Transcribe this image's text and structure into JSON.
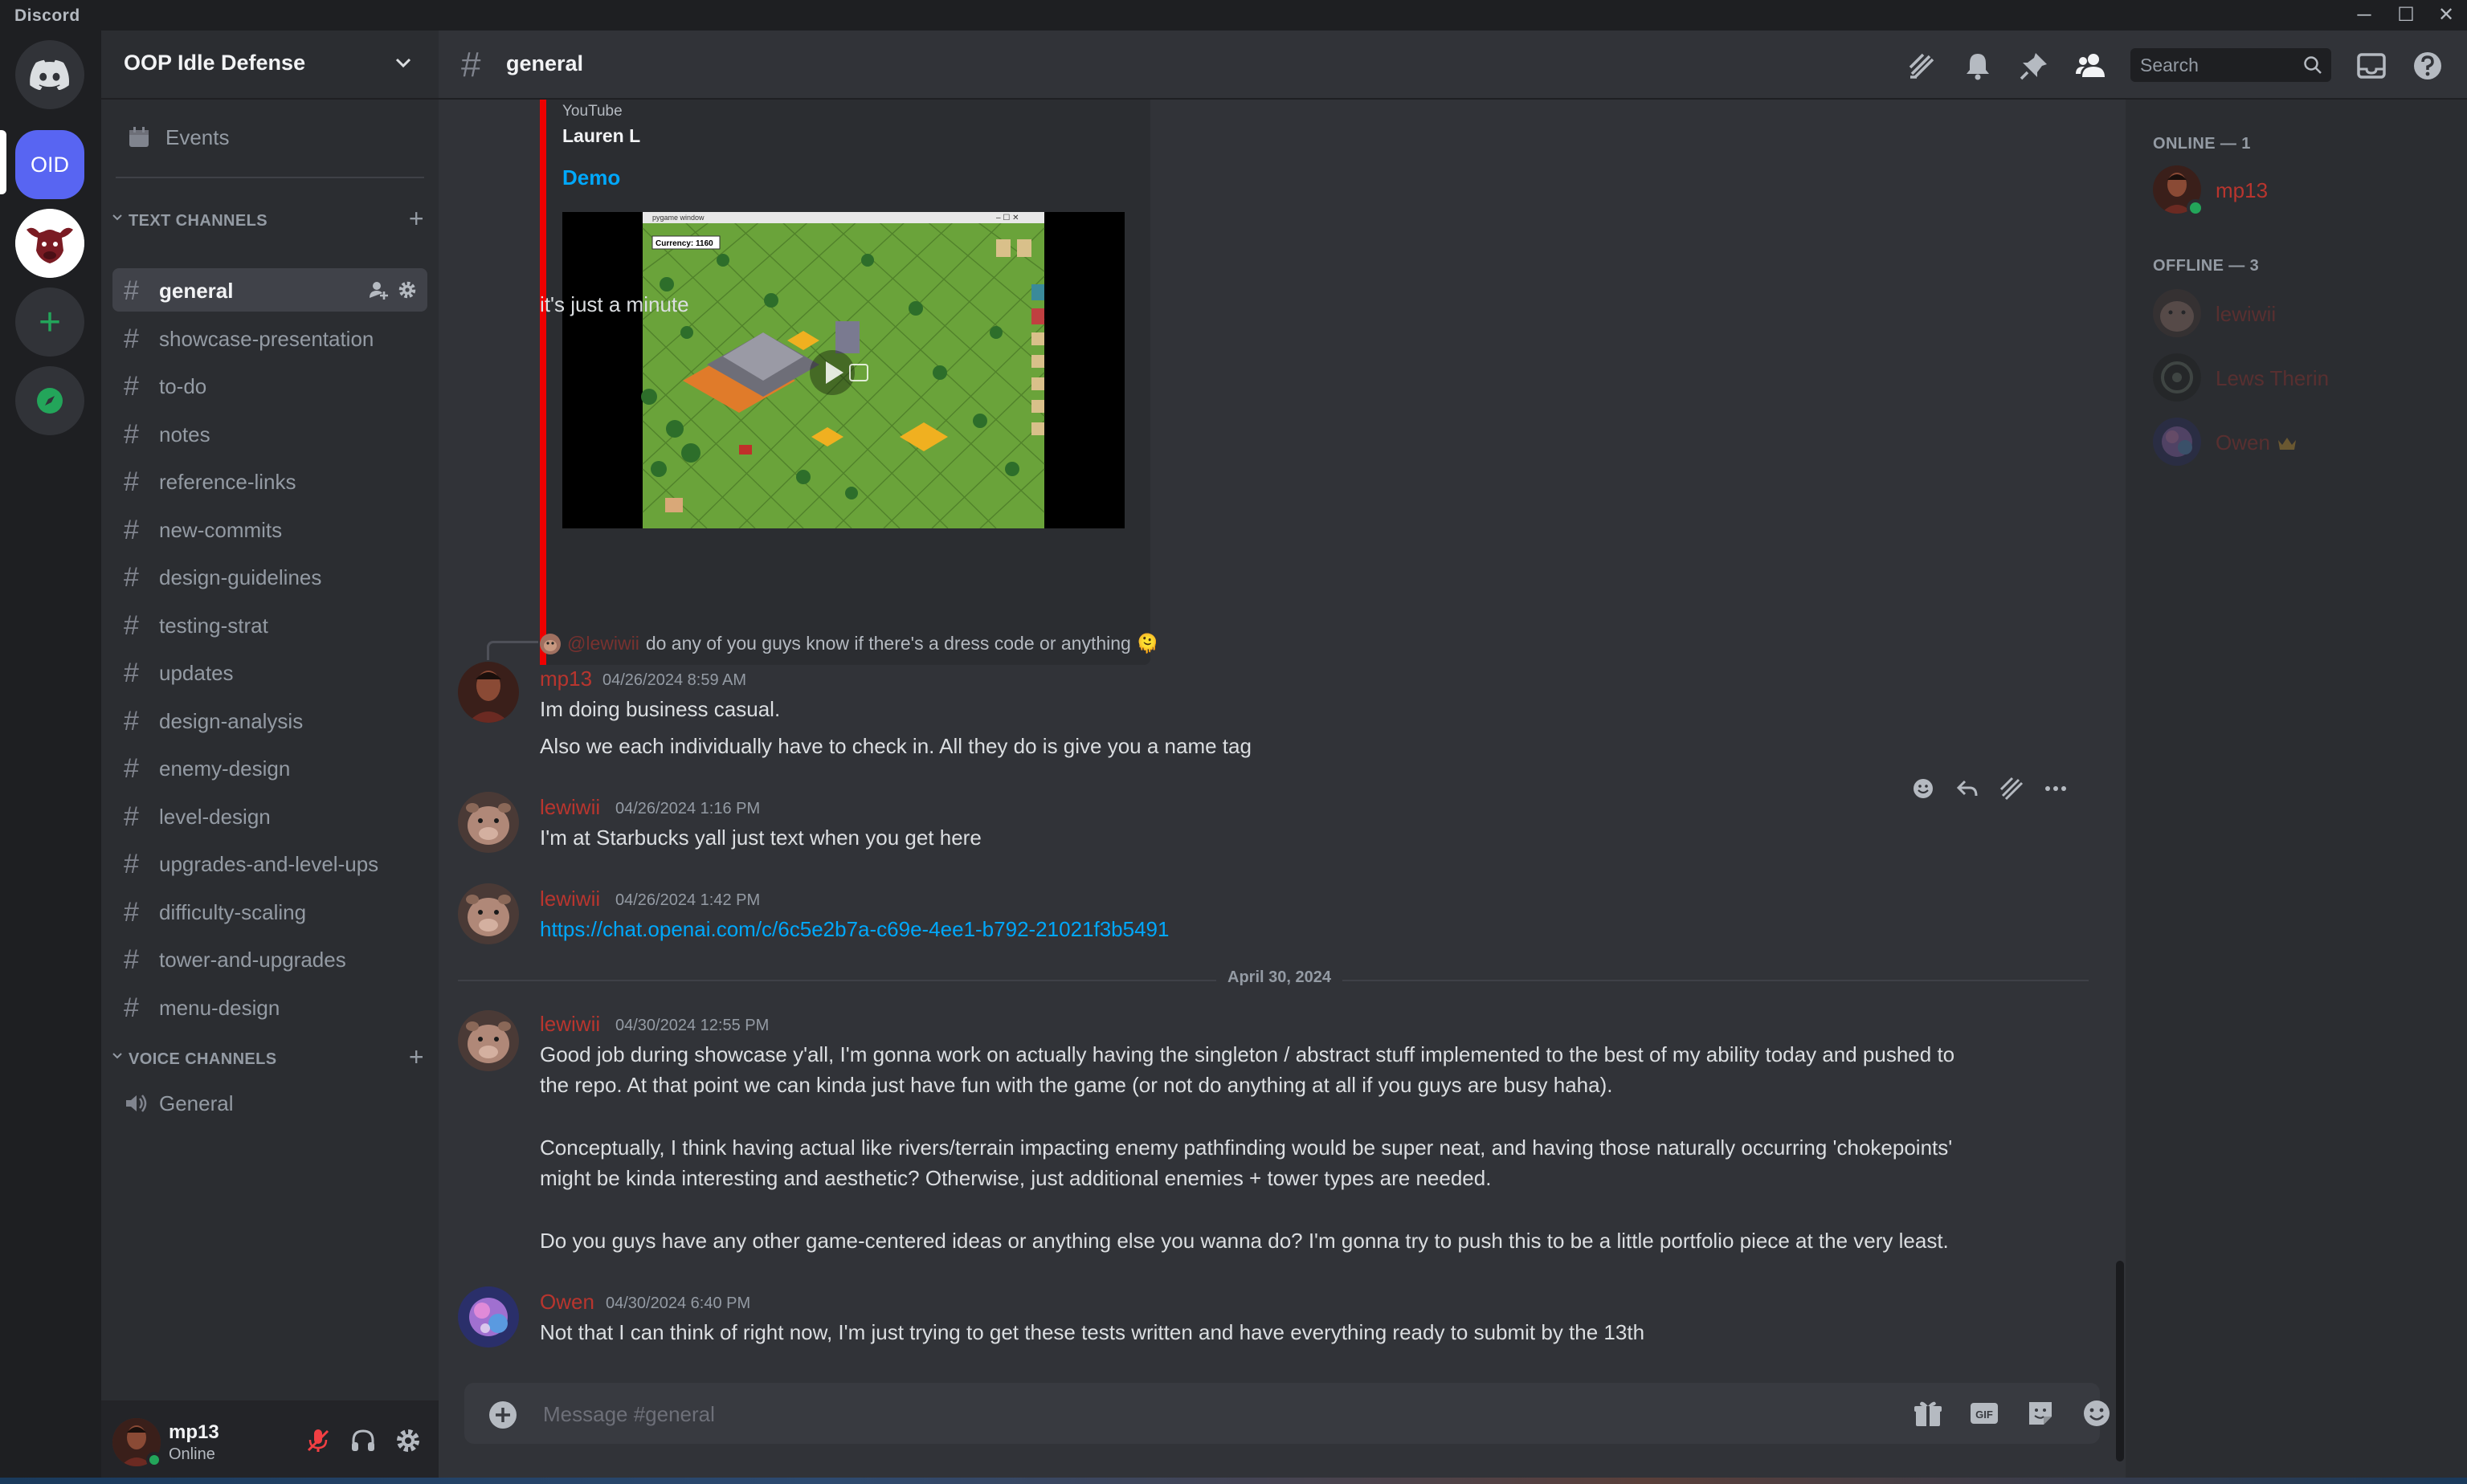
{
  "app": {
    "title": "Discord"
  },
  "server": {
    "name": "OOP Idle Defense",
    "rail": {
      "active_label": "OID"
    }
  },
  "sidebar": {
    "events_label": "Events",
    "text_category": "TEXT CHANNELS",
    "voice_category": "VOICE CHANNELS",
    "text_channels": [
      "general",
      "showcase-presentation",
      "to-do",
      "notes",
      "reference-links",
      "new-commits",
      "design-guidelines",
      "testing-strat",
      "updates",
      "design-analysis",
      "enemy-design",
      "level-design",
      "upgrades-and-level-ups",
      "difficulty-scaling",
      "tower-and-upgrades",
      "menu-design"
    ],
    "active_channel_index": 0,
    "voice_channels": [
      "General"
    ]
  },
  "user_panel": {
    "name": "mp13",
    "status": "Online"
  },
  "channel_header": {
    "name": "general",
    "search_placeholder": "Search"
  },
  "embed": {
    "provider": "YouTube",
    "author": "Lauren L",
    "title": "Demo",
    "video_currency": "Currency: 1160",
    "video_window_title": "pygame window"
  },
  "messages": {
    "m0": {
      "text": "it's just a minute"
    },
    "reply": {
      "mention": "@lewiwii",
      "text": "do any of you guys know if there's a dress code or anything 🫠"
    },
    "m1": {
      "author": "mp13",
      "timestamp": "04/26/2024 8:59 AM",
      "lines": [
        "Im doing business casual.",
        "Also we each individually have to check in. All they do is give you a name tag"
      ]
    },
    "m2": {
      "author": "lewiwii",
      "timestamp": "04/26/2024 1:16 PM",
      "text": "I'm at Starbucks yall just text when you get here"
    },
    "m3": {
      "author": "lewiwii",
      "timestamp": "04/26/2024 1:42 PM",
      "link": "https://chat.openai.com/c/6c5e2b7a-c69e-4ee1-b792-21021f3b5491"
    },
    "date_divider": "April 30, 2024",
    "m4": {
      "author": "lewiwii",
      "timestamp": "04/30/2024 12:55 PM",
      "lines": [
        "Good job during showcase y'all, I'm gonna work on actually having the singleton / abstract stuff implemented to the best of my ability today and pushed to",
        "the repo. At that point we can kinda just have fun with the game (or not do anything at all if you guys are busy haha).",
        "Conceptually, I think having actual like rivers/terrain impacting enemy pathfinding would be super neat, and having those naturally occurring 'chokepoints'",
        "might be kinda interesting and aesthetic? Otherwise, just additional enemies + tower types are needed.",
        "Do you guys have any other game-centered ideas or anything else you wanna do? I'm gonna try to push this to be a little portfolio piece at the very least."
      ]
    },
    "m5": {
      "author": "Owen",
      "timestamp": "04/30/2024 6:40 PM",
      "text": "Not that I can think of right now, I'm just trying to get these tests written and have everything ready to submit by the 13th"
    }
  },
  "composer": {
    "placeholder": "Message #general"
  },
  "members": {
    "online_header": "ONLINE — 1",
    "offline_header": "OFFLINE — 3",
    "online": [
      {
        "name": "mp13"
      }
    ],
    "offline": [
      {
        "name": "lewiwii"
      },
      {
        "name": "Lews Therin"
      },
      {
        "name": "Owen"
      }
    ]
  },
  "colors": {
    "accent": "#5865f2",
    "online": "#23a55a",
    "role_red": "#b8352e",
    "link": "#00a8fc",
    "embed_bar": "#ee0000"
  },
  "icons": [
    "discord-logo-icon",
    "chevron-down-icon",
    "calendar-icon",
    "hash-icon",
    "speaker-icon",
    "threads-icon",
    "bell-icon",
    "pin-icon",
    "members-icon",
    "search-icon",
    "inbox-icon",
    "help-icon",
    "mic-muted-icon",
    "headphones-icon",
    "gear-icon",
    "gift-icon",
    "gif-icon",
    "sticker-icon",
    "emoji-icon",
    "plus-circle-icon",
    "reply-icon",
    "more-icon"
  ]
}
